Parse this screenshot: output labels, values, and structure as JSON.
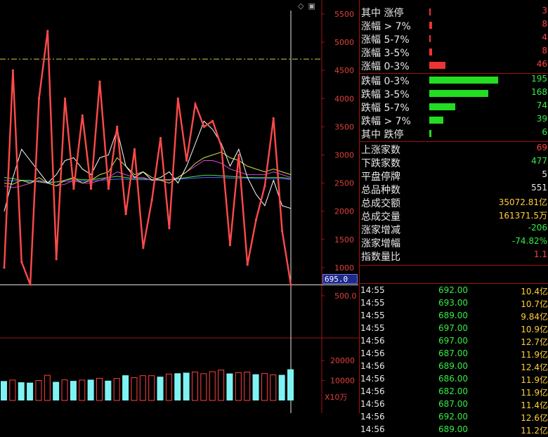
{
  "chart_data": {
    "type": "line",
    "price_axis": [
      "5500",
      "5000",
      "4500",
      "4000",
      "3500",
      "3000",
      "2500",
      "2000",
      "1500",
      "1000",
      "500.0"
    ],
    "ylim": [
      0,
      5800
    ],
    "volume_axis": [
      "20000",
      "10000"
    ],
    "volume_unit": "X10万",
    "current_label": "695.0",
    "current_value": 695,
    "ref_value": 4700,
    "series": [
      {
        "values": [
          1000,
          4500,
          1100,
          700,
          4000,
          5200,
          1150,
          4000,
          2400,
          3700,
          2400,
          4300,
          2400,
          3500,
          1950,
          3100,
          1350,
          2200,
          3300,
          1700,
          4000,
          2900,
          3900,
          3500,
          3600,
          3150,
          1400,
          3000,
          1050,
          1850,
          2450,
          3650,
          1650,
          695
        ],
        "color": "#ff4a4a"
      },
      {
        "values": [
          2000,
          2600,
          3100,
          2900,
          2700,
          2500,
          2650,
          2900,
          2950,
          2750,
          2650,
          2950,
          3000,
          3450,
          2800,
          2600,
          2700,
          2550,
          2600,
          2700,
          2500,
          2800,
          3200,
          3600,
          3450,
          3200,
          2800,
          3100,
          2600,
          2300,
          2100,
          2550,
          2100,
          2050
        ],
        "color": "#ffffff"
      },
      {
        "values": [
          2500,
          2480,
          2550,
          2500,
          2600,
          2500,
          2450,
          2550,
          2600,
          2500,
          2550,
          2650,
          2700,
          2950,
          2800,
          2650,
          2700,
          2600,
          2550,
          2500,
          2600,
          2700,
          2850,
          2950,
          3000,
          3050,
          2950,
          2900,
          2800,
          2750,
          2700,
          2750,
          2700,
          2650
        ],
        "color": "#d4e04a"
      },
      {
        "values": [
          2450,
          2420,
          2450,
          2500,
          2550,
          2500,
          2450,
          2480,
          2550,
          2500,
          2500,
          2550,
          2600,
          2700,
          2650,
          2600,
          2600,
          2550,
          2550,
          2550,
          2600,
          2700,
          2800,
          2900,
          2900,
          2850,
          2750,
          2700,
          2650,
          2650,
          2650,
          2700,
          2650,
          2600
        ],
        "color": "#e040e0"
      },
      {
        "values": [
          2600,
          2580,
          2550,
          2550,
          2520,
          2500,
          2520,
          2550,
          2580,
          2560,
          2560,
          2580,
          2600,
          2620,
          2600,
          2580,
          2580,
          2560,
          2560,
          2560,
          2580,
          2600,
          2620,
          2640,
          2640,
          2630,
          2620,
          2610,
          2600,
          2600,
          2600,
          2600,
          2600,
          2580
        ],
        "color": "#4fe04f"
      },
      {
        "values": [
          2550,
          2540,
          2540,
          2530,
          2530,
          2520,
          2520,
          2530,
          2540,
          2540,
          2540,
          2550,
          2560,
          2570,
          2570,
          2560,
          2560,
          2560,
          2560,
          2560,
          2570,
          2580,
          2590,
          2600,
          2600,
          2600,
          2590,
          2590,
          2590,
          2580,
          2580,
          2580,
          2580,
          2560
        ],
        "color": "#4a6cff"
      }
    ],
    "volume": [
      {
        "v": 9700,
        "c": "cyan"
      },
      {
        "v": 10200,
        "c": "red"
      },
      {
        "v": 9100,
        "c": "cyan"
      },
      {
        "v": 8900,
        "c": "cyan"
      },
      {
        "v": 10000,
        "c": "red"
      },
      {
        "v": 12600,
        "c": "red"
      },
      {
        "v": 9300,
        "c": "cyan"
      },
      {
        "v": 10300,
        "c": "red"
      },
      {
        "v": 9800,
        "c": "cyan"
      },
      {
        "v": 10200,
        "c": "red"
      },
      {
        "v": 10400,
        "c": "cyan"
      },
      {
        "v": 11100,
        "c": "red"
      },
      {
        "v": 9900,
        "c": "cyan"
      },
      {
        "v": 11000,
        "c": "red"
      },
      {
        "v": 12600,
        "c": "cyan"
      },
      {
        "v": 11400,
        "c": "red"
      },
      {
        "v": 12400,
        "c": "red"
      },
      {
        "v": 12400,
        "c": "red"
      },
      {
        "v": 11900,
        "c": "cyan"
      },
      {
        "v": 13200,
        "c": "red"
      },
      {
        "v": 13600,
        "c": "cyan"
      },
      {
        "v": 13900,
        "c": "cyan"
      },
      {
        "v": 14200,
        "c": "red"
      },
      {
        "v": 13400,
        "c": "red"
      },
      {
        "v": 14400,
        "c": "red"
      },
      {
        "v": 15200,
        "c": "red"
      },
      {
        "v": 13500,
        "c": "cyan"
      },
      {
        "v": 13900,
        "c": "red"
      },
      {
        "v": 14200,
        "c": "red"
      },
      {
        "v": 13100,
        "c": "cyan"
      },
      {
        "v": 13500,
        "c": "red"
      },
      {
        "v": 12800,
        "c": "red"
      },
      {
        "v": 12800,
        "c": "cyan"
      },
      {
        "v": 15600,
        "c": "cyan"
      }
    ],
    "volume_max": 26000
  },
  "panel": {
    "breadth": [
      {
        "label": "其中 涨停",
        "value": "3",
        "bar": 3,
        "type": "up"
      },
      {
        "label": "涨幅 > 7%",
        "value": "8",
        "bar": 8,
        "type": "up"
      },
      {
        "label": "涨幅 5-7%",
        "value": "4",
        "bar": 4,
        "type": "up"
      },
      {
        "label": "涨幅 3-5%",
        "value": "8",
        "bar": 8,
        "type": "up"
      },
      {
        "label": "涨幅 0-3%",
        "value": "46",
        "bar": 46,
        "type": "up"
      },
      {
        "label": "跌幅 0-3%",
        "value": "195",
        "bar": 195,
        "type": "down"
      },
      {
        "label": "跌幅 3-5%",
        "value": "168",
        "bar": 168,
        "type": "down"
      },
      {
        "label": "跌幅 5-7%",
        "value": "74",
        "bar": 74,
        "type": "down"
      },
      {
        "label": "跌幅 > 7%",
        "value": "39",
        "bar": 39,
        "type": "down"
      },
      {
        "label": "其中 跌停",
        "value": "6",
        "bar": 6,
        "type": "down"
      }
    ],
    "stats": [
      {
        "label": "上涨家数",
        "value": "69",
        "color": "red"
      },
      {
        "label": "下跌家数",
        "value": "477",
        "color": "grn"
      },
      {
        "label": "平盘停牌",
        "value": "5",
        "color": "wht"
      },
      {
        "label": "总品种数",
        "value": "551",
        "color": "wht"
      },
      {
        "label": "总成交额",
        "value": "35072.81亿",
        "color": "yel"
      },
      {
        "label": "总成交量",
        "value": "161371.5万",
        "color": "yel"
      },
      {
        "label": "涨家增减",
        "value": "-206",
        "color": "grn"
      },
      {
        "label": "涨家增幅",
        "value": "-74.82%",
        "color": "grn"
      },
      {
        "label": "指数量比",
        "value": "1.1",
        "color": "red"
      }
    ],
    "ticks": [
      {
        "time": "14:55",
        "price": "692.00",
        "vol": "10.4亿"
      },
      {
        "time": "14:55",
        "price": "693.00",
        "vol": "10.7亿"
      },
      {
        "time": "14:55",
        "price": "689.00",
        "vol": "9.84亿"
      },
      {
        "time": "14:55",
        "price": "697.00",
        "vol": "10.9亿"
      },
      {
        "time": "14:56",
        "price": "697.00",
        "vol": "12.7亿"
      },
      {
        "time": "14:56",
        "price": "687.00",
        "vol": "11.9亿"
      },
      {
        "time": "14:56",
        "price": "689.00",
        "vol": "12.4亿"
      },
      {
        "time": "14:56",
        "price": "686.00",
        "vol": "11.9亿"
      },
      {
        "time": "14:56",
        "price": "682.00",
        "vol": "11.9亿"
      },
      {
        "time": "14:56",
        "price": "687.00",
        "vol": "11.4亿"
      },
      {
        "time": "14:56",
        "price": "692.00",
        "vol": "12.6亿"
      },
      {
        "time": "14:56",
        "price": "689.00",
        "vol": "11.2亿"
      }
    ]
  },
  "icons": [
    "diamond-icon",
    "window-icon"
  ],
  "colors": {
    "accent_red": "#ff4040",
    "down_green": "#22dd22",
    "volume_cyan": "#7ff3f3",
    "grid": "#a01010"
  }
}
